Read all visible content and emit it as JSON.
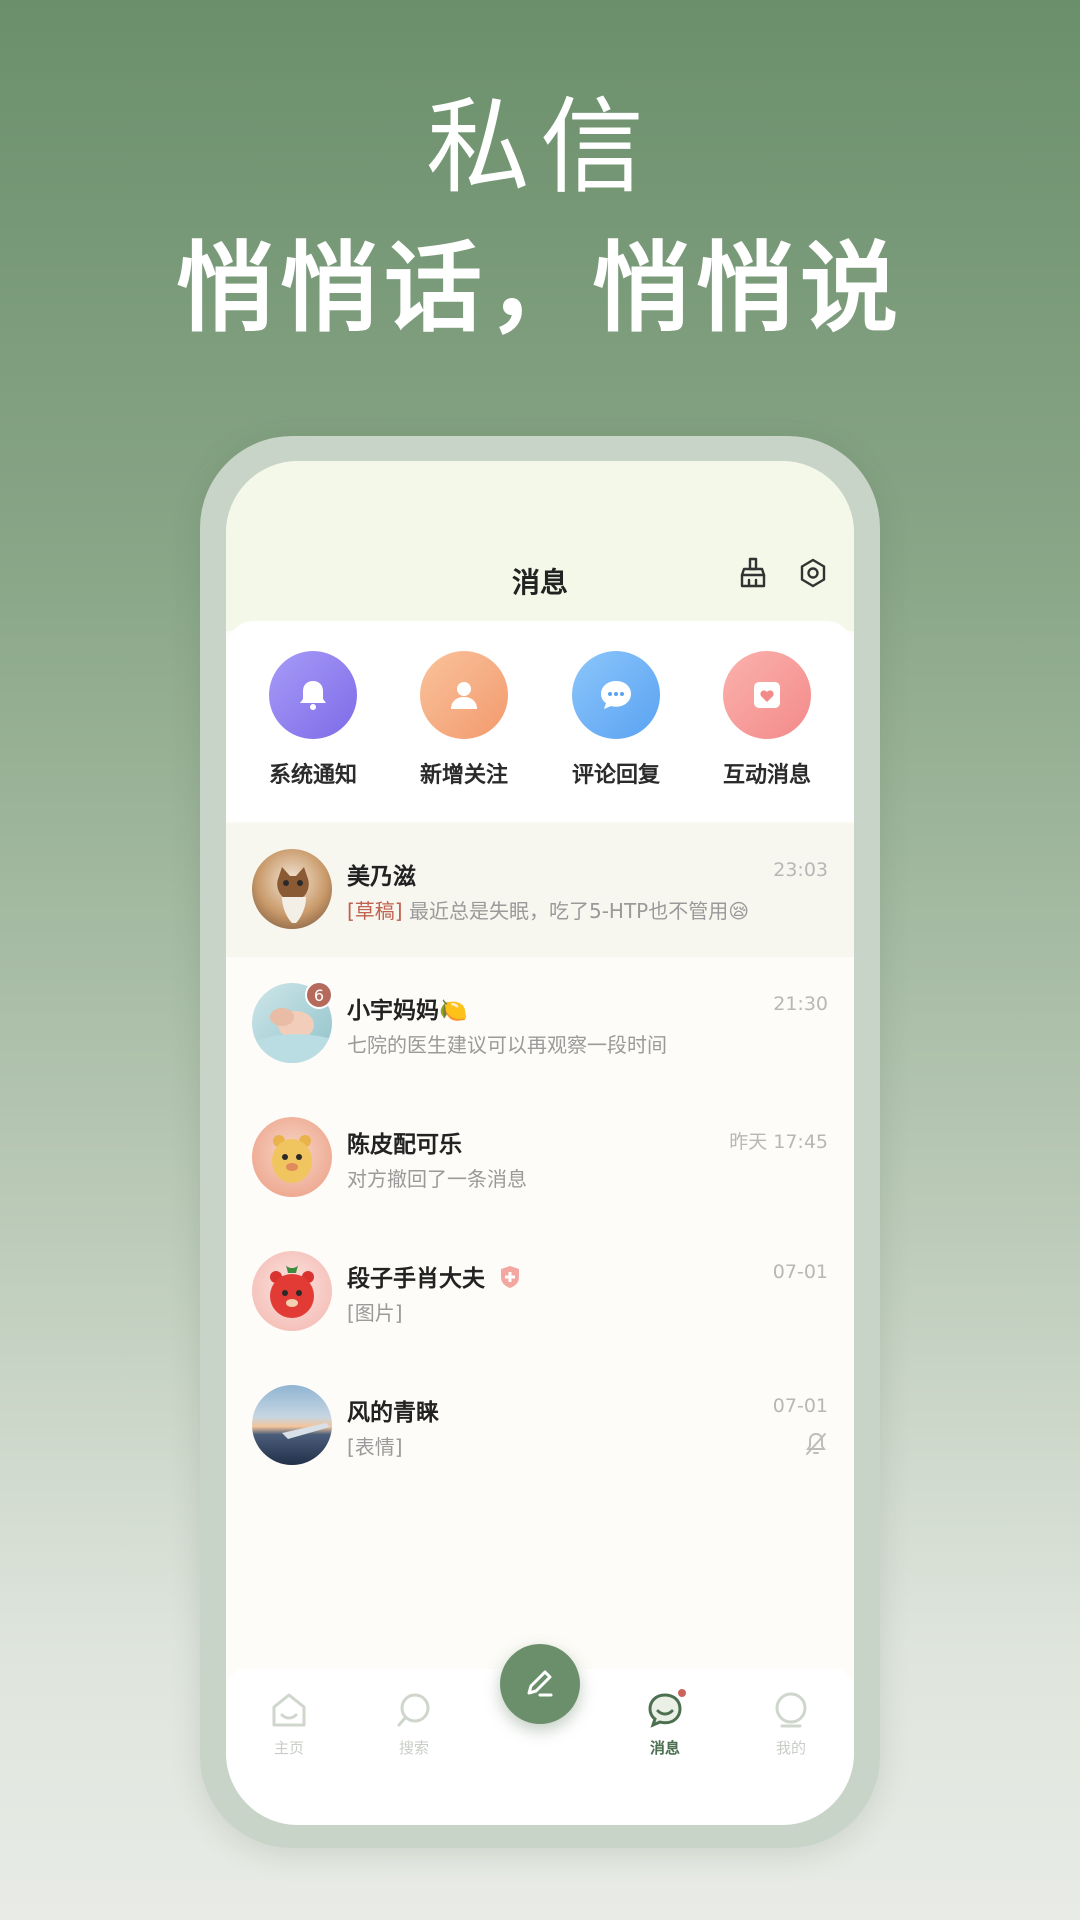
{
  "hero": {
    "title": "私信",
    "subtitle": "悄悄话，悄悄说"
  },
  "nav": {
    "title": "消息",
    "clean_icon": "broom-icon",
    "settings_icon": "hexagon-settings-icon"
  },
  "quick_actions": [
    {
      "label": "系统通知",
      "icon": "bell-icon",
      "color": "#8f7ff0"
    },
    {
      "label": "新增关注",
      "icon": "person-icon",
      "color": "#f4a978"
    },
    {
      "label": "评论回复",
      "icon": "chat-bubble-icon",
      "color": "#6aaff6"
    },
    {
      "label": "互动消息",
      "icon": "heart-card-icon",
      "color": "#f59a9a"
    }
  ],
  "messages": [
    {
      "name": "美乃滋",
      "time": "23:03",
      "draft_tag": "[草稿]",
      "preview": " 最近总是失眠，吃了5-HTP也不管用😪"
    },
    {
      "name": "小宇妈妈🍋",
      "time": "21:30",
      "preview": "七院的医生建议可以再观察一段时间",
      "badge": "6"
    },
    {
      "name": "陈皮配可乐",
      "time": "昨天 17:45",
      "preview": "对方撤回了一条消息"
    },
    {
      "name": "段子手肖大夫",
      "time": "07-01",
      "preview": "[图片]"
    },
    {
      "name": "风的青睐",
      "time": "07-01",
      "preview": "[表情]",
      "muted": true
    }
  ],
  "tabbar": {
    "tabs": [
      {
        "label": "主页"
      },
      {
        "label": "搜索"
      },
      {
        "label": "消息",
        "active": true
      },
      {
        "label": "我的"
      }
    ],
    "fab_icon": "pen-icon",
    "accent": "#6b8f6b"
  }
}
